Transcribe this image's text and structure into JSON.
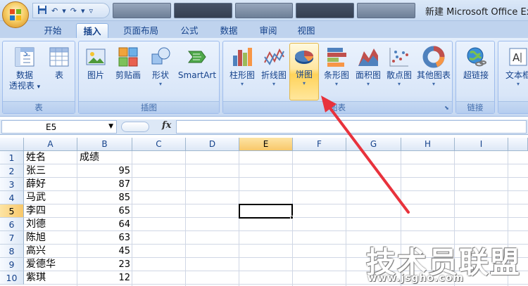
{
  "window": {
    "title": "新建 Microsoft Office Ex"
  },
  "tabs": [
    "开始",
    "插入",
    "页面布局",
    "公式",
    "数据",
    "审阅",
    "视图"
  ],
  "active_tab": "插入",
  "ribbon": {
    "groups": {
      "tables": {
        "label": "表",
        "buttons": {
          "pivot_line1": "数据",
          "pivot_line2": "透视表",
          "table": "表"
        }
      },
      "illustrations": {
        "label": "插图",
        "buttons": {
          "picture": "图片",
          "clipart": "剪贴画",
          "shapes": "形状",
          "smartart": "SmartArt"
        }
      },
      "charts": {
        "label": "图表",
        "buttons": {
          "column": "柱形图",
          "line": "折线图",
          "pie": "饼图",
          "bar": "条形图",
          "area": "面积图",
          "scatter": "散点图",
          "other": "其他图表"
        }
      },
      "links": {
        "label": "链接",
        "buttons": {
          "hyperlink": "超链接"
        }
      },
      "text": {
        "label": "",
        "buttons": {
          "textbox": "文本框"
        }
      }
    },
    "highlighted_button": "饼图",
    "dropdown_glyph": "▾",
    "launcher_glyph": "⬊"
  },
  "formula_bar": {
    "name_box": "E5",
    "fx_label": "fx",
    "value": ""
  },
  "columns": [
    "A",
    "B",
    "C",
    "D",
    "E",
    "F",
    "G",
    "H",
    "I"
  ],
  "selected_column": "E",
  "selected_row": "5",
  "rows": [
    {
      "num": "1",
      "a": "姓名",
      "b": "成绩"
    },
    {
      "num": "2",
      "a": "张三",
      "b": "95"
    },
    {
      "num": "3",
      "a": "薛好",
      "b": "87"
    },
    {
      "num": "4",
      "a": "马武",
      "b": "85"
    },
    {
      "num": "5",
      "a": "李四",
      "b": "65"
    },
    {
      "num": "6",
      "a": "刘德",
      "b": "64"
    },
    {
      "num": "7",
      "a": "陈旭",
      "b": "63"
    },
    {
      "num": "8",
      "a": "高兴",
      "b": "45"
    },
    {
      "num": "9",
      "a": "爱德华",
      "b": "23"
    },
    {
      "num": "10",
      "a": "紫琪",
      "b": "12"
    }
  ],
  "watermark": {
    "main": "技术员联盟",
    "sub": "www.jsgho.com"
  },
  "colors": {
    "annotation_arrow": "#e8323c",
    "ribbon_highlight": "#ffd35a",
    "selection_border": "#000000"
  }
}
